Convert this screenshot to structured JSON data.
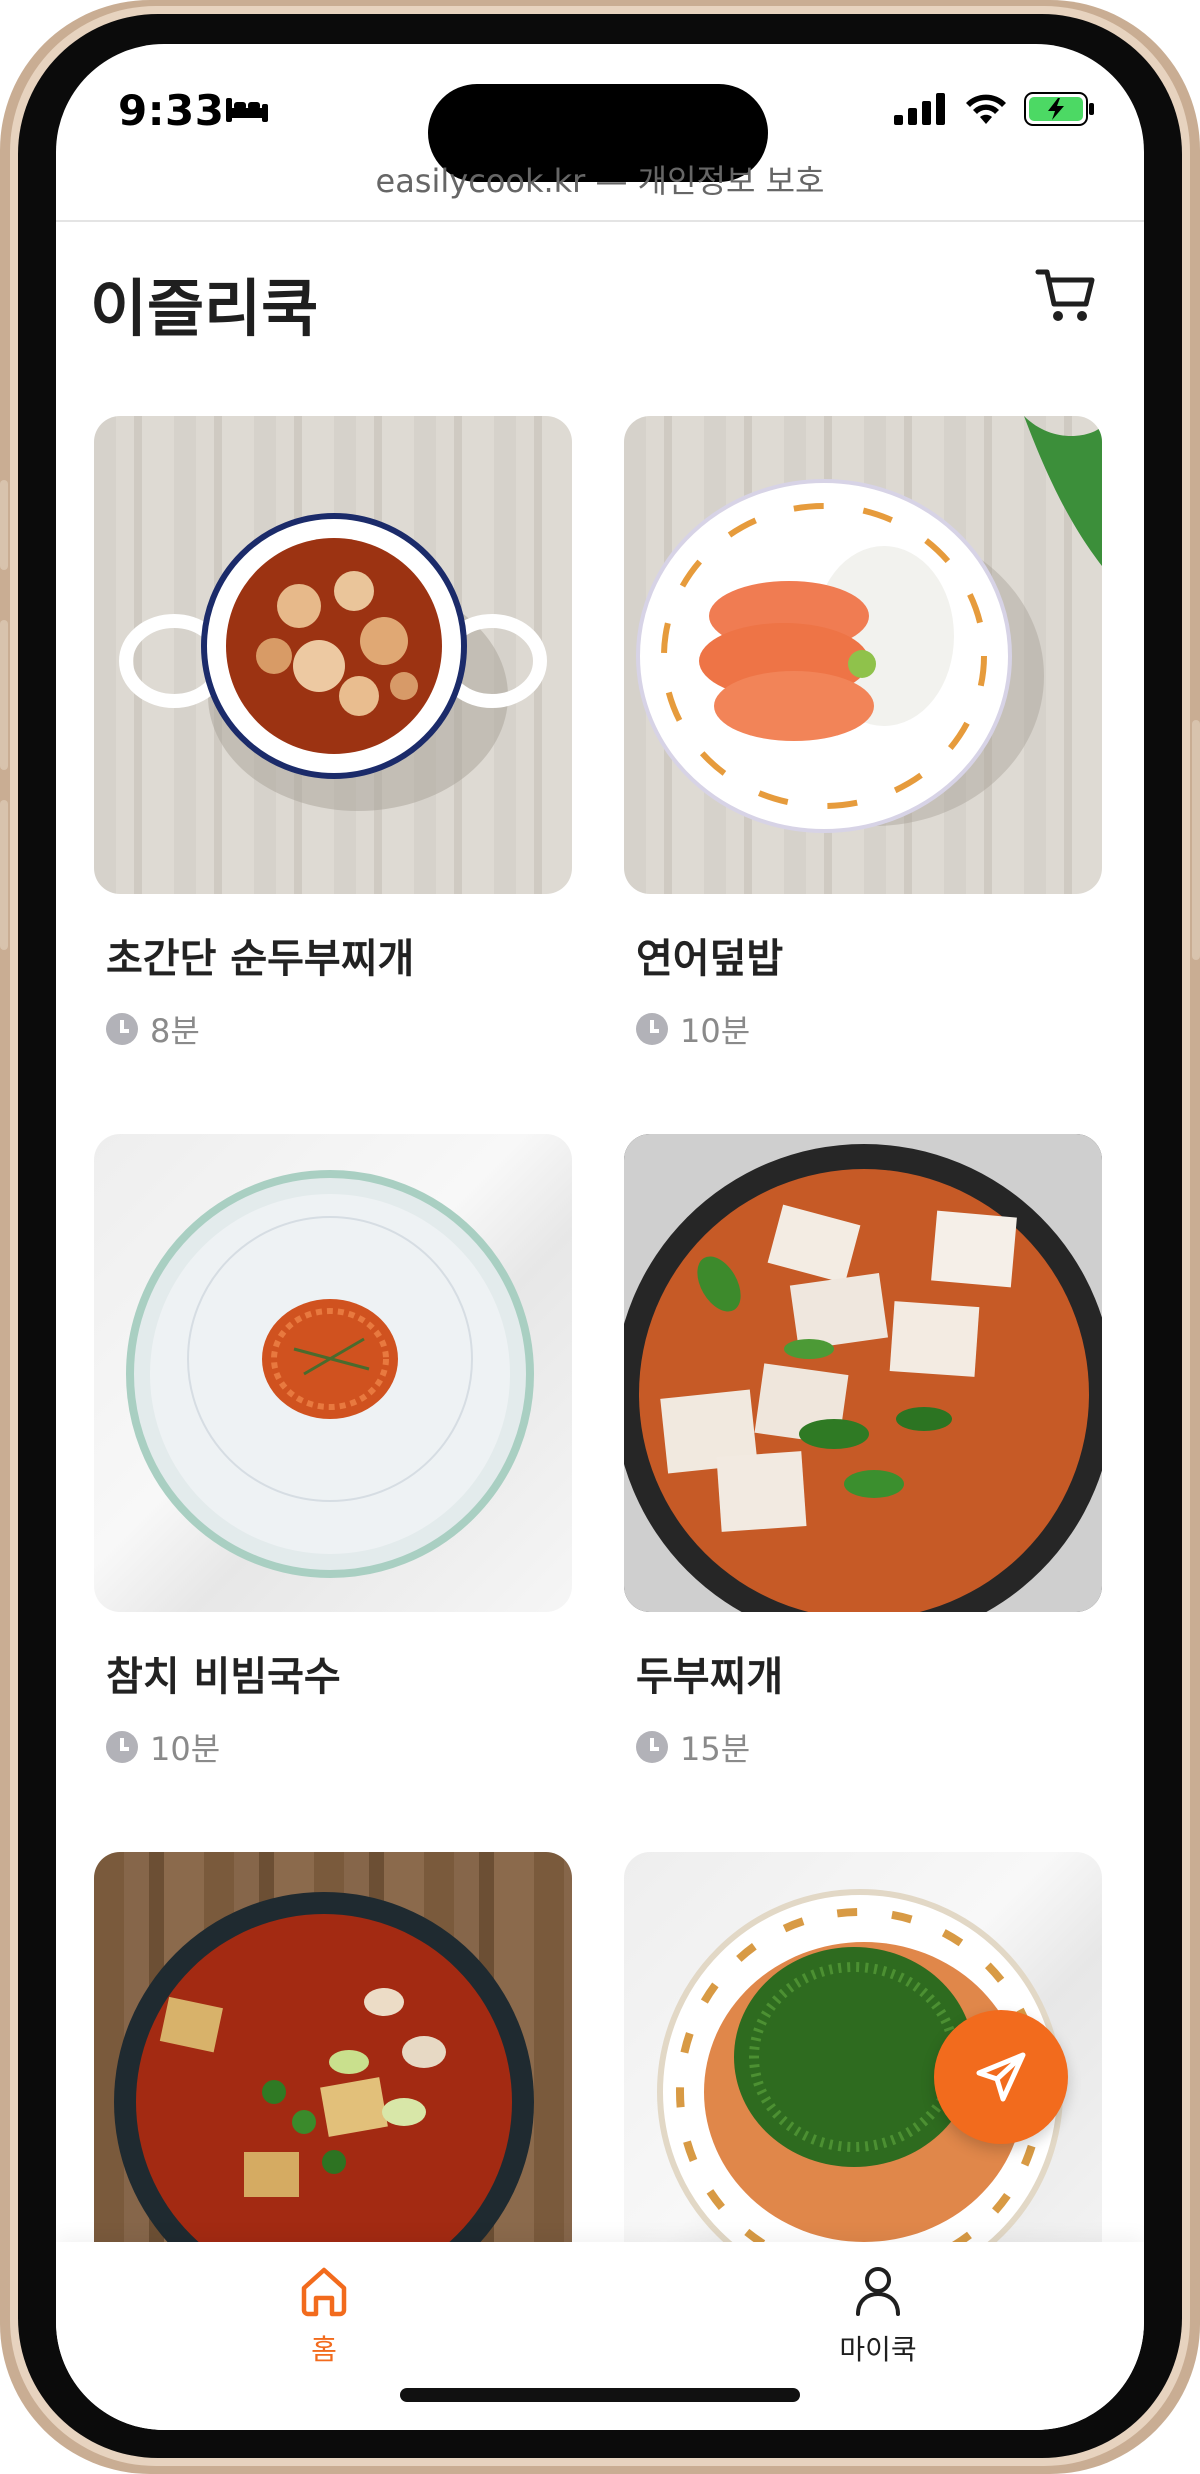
{
  "status_bar": {
    "time": "9:33",
    "battery_color": "#4cd964"
  },
  "browser": {
    "url_text": "easilycook.kr — 개인정보 보호"
  },
  "header": {
    "title": "이즐리쿡"
  },
  "recipes": [
    {
      "name": "초간단 순두부찌개",
      "time": "8분",
      "image": "tofu-stew-bowl"
    },
    {
      "name": "연어덮밥",
      "time": "10분",
      "image": "salmon-rice-bowl"
    },
    {
      "name": "참치 비빔국수",
      "time": "10분",
      "image": "tuna-noodles-plate"
    },
    {
      "name": "두부찌개",
      "time": "15분",
      "image": "tofu-stew-pot"
    },
    {
      "name": "",
      "time": "",
      "image": "spicy-stew-pot"
    },
    {
      "name": "",
      "time": "",
      "image": "chive-rice-plate"
    }
  ],
  "tabs": [
    {
      "label": "홈",
      "icon": "home-icon",
      "active": true
    },
    {
      "label": "마이쿡",
      "icon": "person-icon",
      "active": false
    }
  ],
  "colors": {
    "accent": "#f26b1d",
    "text": "#1f1f1f",
    "muted": "#8a8a8a"
  }
}
